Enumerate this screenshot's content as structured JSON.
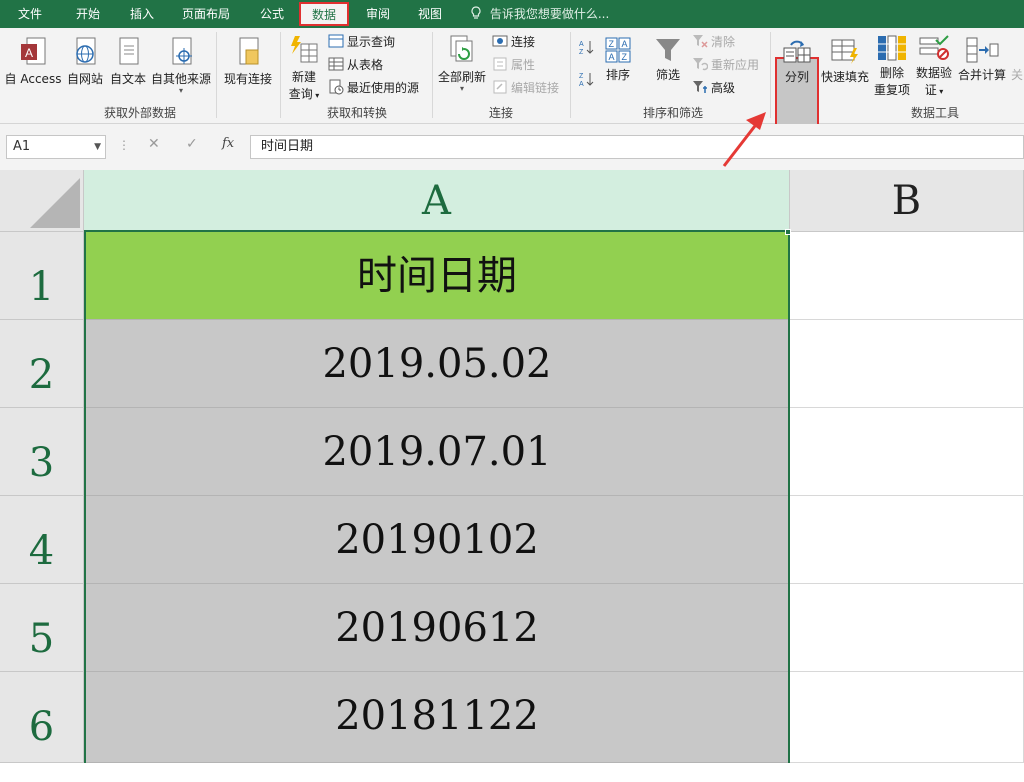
{
  "menu": {
    "tabs": [
      "文件",
      "开始",
      "插入",
      "页面布局",
      "公式",
      "数据",
      "审阅",
      "视图"
    ],
    "active_tab": "数据",
    "tell_me": "告诉我您想要做什么..."
  },
  "ribbon": {
    "groups": {
      "external": "获取外部数据",
      "transform": "获取和转换",
      "connections": "连接",
      "sort_filter": "排序和筛选",
      "data_tools": "数据工具"
    },
    "buttons": {
      "access": "自 Access",
      "web": "自网站",
      "text": "自文本",
      "other": "自其他来源",
      "existing": "现有连接",
      "new_query_1": "新建",
      "new_query_2": "查询",
      "show_query": "显示查询",
      "from_table": "从表格",
      "recent_sources": "最近使用的源",
      "refresh_all": "全部刷新",
      "connections": "连接",
      "properties": "属性",
      "edit_links": "编辑链接",
      "sort": "排序",
      "filter": "筛选",
      "clear": "清除",
      "reapply": "重新应用",
      "advanced": "高级",
      "split": "分列",
      "flash_fill": "快速填充",
      "remove_dup_1": "删除",
      "remove_dup_2": "重复项",
      "validation_1": "数据验",
      "validation_2": "证",
      "consolidate": "合并计算",
      "cut_off": "关"
    }
  },
  "formula_bar": {
    "name_box": "A1",
    "formula": "时间日期",
    "fx": "fx"
  },
  "sheet": {
    "columns": [
      "A",
      "B"
    ],
    "rows": [
      {
        "num": "1",
        "value": "时间日期"
      },
      {
        "num": "2",
        "value": "2019.05.02"
      },
      {
        "num": "3",
        "value": "2019.07.01"
      },
      {
        "num": "4",
        "value": "20190102"
      },
      {
        "num": "5",
        "value": "20190612"
      },
      {
        "num": "6",
        "value": "20181122"
      }
    ]
  },
  "colors": {
    "excel_green": "#217346",
    "header_fill": "#92d050",
    "data_fill": "#c8c8c8",
    "highlight_red": "#e03030"
  }
}
